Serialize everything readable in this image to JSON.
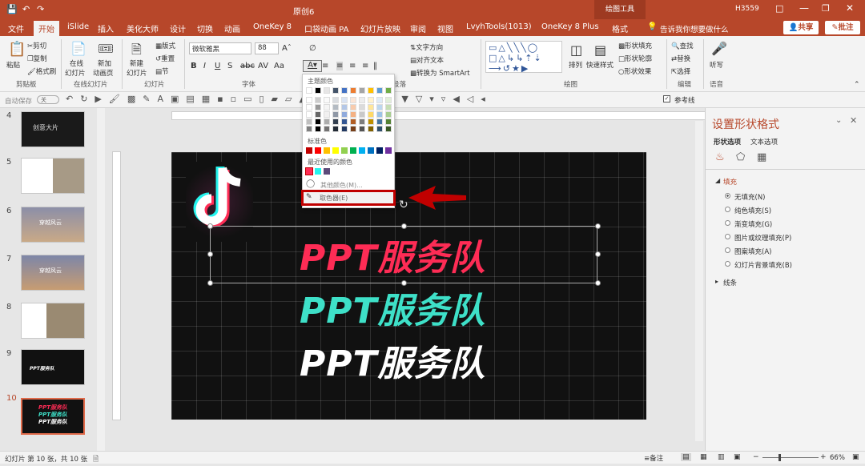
{
  "titlebar": {
    "title": "原创6",
    "context_tab": "绘图工具",
    "user": "H3559"
  },
  "tabs": [
    "文件",
    "开始",
    "iSlide",
    "插入",
    "美化大师",
    "设计",
    "切换",
    "动画",
    "OneKey 8",
    "口袋动画 PA",
    "幻灯片放映",
    "审阅",
    "视图",
    "LvyhTools(1013)",
    "OneKey 8 Plus",
    "格式"
  ],
  "search_placeholder": "告诉我你想要做什么",
  "share_label": "共享",
  "comment_label": "批注",
  "ribbon": {
    "clipboard": {
      "paste": "粘贴",
      "cut": "剪切",
      "copy": "复制",
      "format_painter": "格式刷",
      "group": "剪贴板"
    },
    "online_slides": {
      "online": "在线",
      "slides_dropdown": "幻灯片",
      "new_anim": "新加",
      "anim_slides": "动画页",
      "group": "在线幻灯片"
    },
    "slides": {
      "new": "新建",
      "slide": "幻灯片",
      "layout": "版式",
      "reset": "重置",
      "section": "节",
      "group": "幻灯片"
    },
    "font": {
      "name": "微软雅黑",
      "size": "88",
      "group": "字体"
    },
    "paragraph": {
      "text_direction": "文字方向",
      "align_text": "对齐文本",
      "smartart": "转换为 SmartArt",
      "group": "段落"
    },
    "drawing": {
      "arrange": "排列",
      "quick_styles": "快速样式",
      "shape_fill": "形状填充",
      "shape_outline": "形状轮廓",
      "shape_effects": "形状效果",
      "group": "绘图"
    },
    "editing": {
      "find": "查找",
      "replace": "替换",
      "select": "选择",
      "group": "编辑"
    },
    "voice": {
      "dictate": "听写",
      "group": "语音"
    }
  },
  "qat": {
    "autosave": "自动保存",
    "autosave_state": "关",
    "guides": "参考线"
  },
  "color_popup": {
    "theme_header": "主题颜色",
    "standard_header": "标准色",
    "recent_header": "最近使用的颜色",
    "more_colors": "其他颜色(M)...",
    "eyedropper": "取色器(E)",
    "theme_top": [
      "#ffffff",
      "#000000",
      "#e7e6e6",
      "#44546a",
      "#4472c4",
      "#ed7d31",
      "#a5a5a5",
      "#ffc000",
      "#5b9bd5",
      "#70ad47"
    ],
    "standard": [
      "#c00000",
      "#ff0000",
      "#ffc000",
      "#ffff00",
      "#92d050",
      "#00b050",
      "#00b0f0",
      "#0070c0",
      "#002060",
      "#7030a0"
    ],
    "recent": [
      "#fe2c55",
      "#25f4ee",
      "#5c4a7a"
    ]
  },
  "slide_text": [
    "PPT服务队",
    "PPT服务队",
    "PPT服务队"
  ],
  "slide_text_colors": [
    "#fe2c55",
    "#3ee0c8",
    "#ffffff"
  ],
  "thumbnails": [
    {
      "num": "4",
      "caption": "创意大片"
    },
    {
      "num": "5",
      "caption": ""
    },
    {
      "num": "6",
      "caption": "穿越风云"
    },
    {
      "num": "7",
      "caption": "穿越风云"
    },
    {
      "num": "8",
      "caption": ""
    },
    {
      "num": "9",
      "caption": "PPT服务队"
    },
    {
      "num": "10",
      "caption": "PPT服务队"
    }
  ],
  "format_pane": {
    "title": "设置形状格式",
    "tab_shape": "形状选项",
    "tab_text": "文本选项",
    "fill_header": "填充",
    "fill_options": [
      "无填充(N)",
      "纯色填充(S)",
      "渐变填充(G)",
      "图片或纹理填充(P)",
      "图案填充(A)",
      "幻灯片背景填充(B)"
    ],
    "line_header": "线条"
  },
  "status": {
    "slide_info": "幻灯片 第 10 张，共 10 张",
    "notes": "备注",
    "zoom": "66%"
  },
  "accent_color": "#b7472a"
}
